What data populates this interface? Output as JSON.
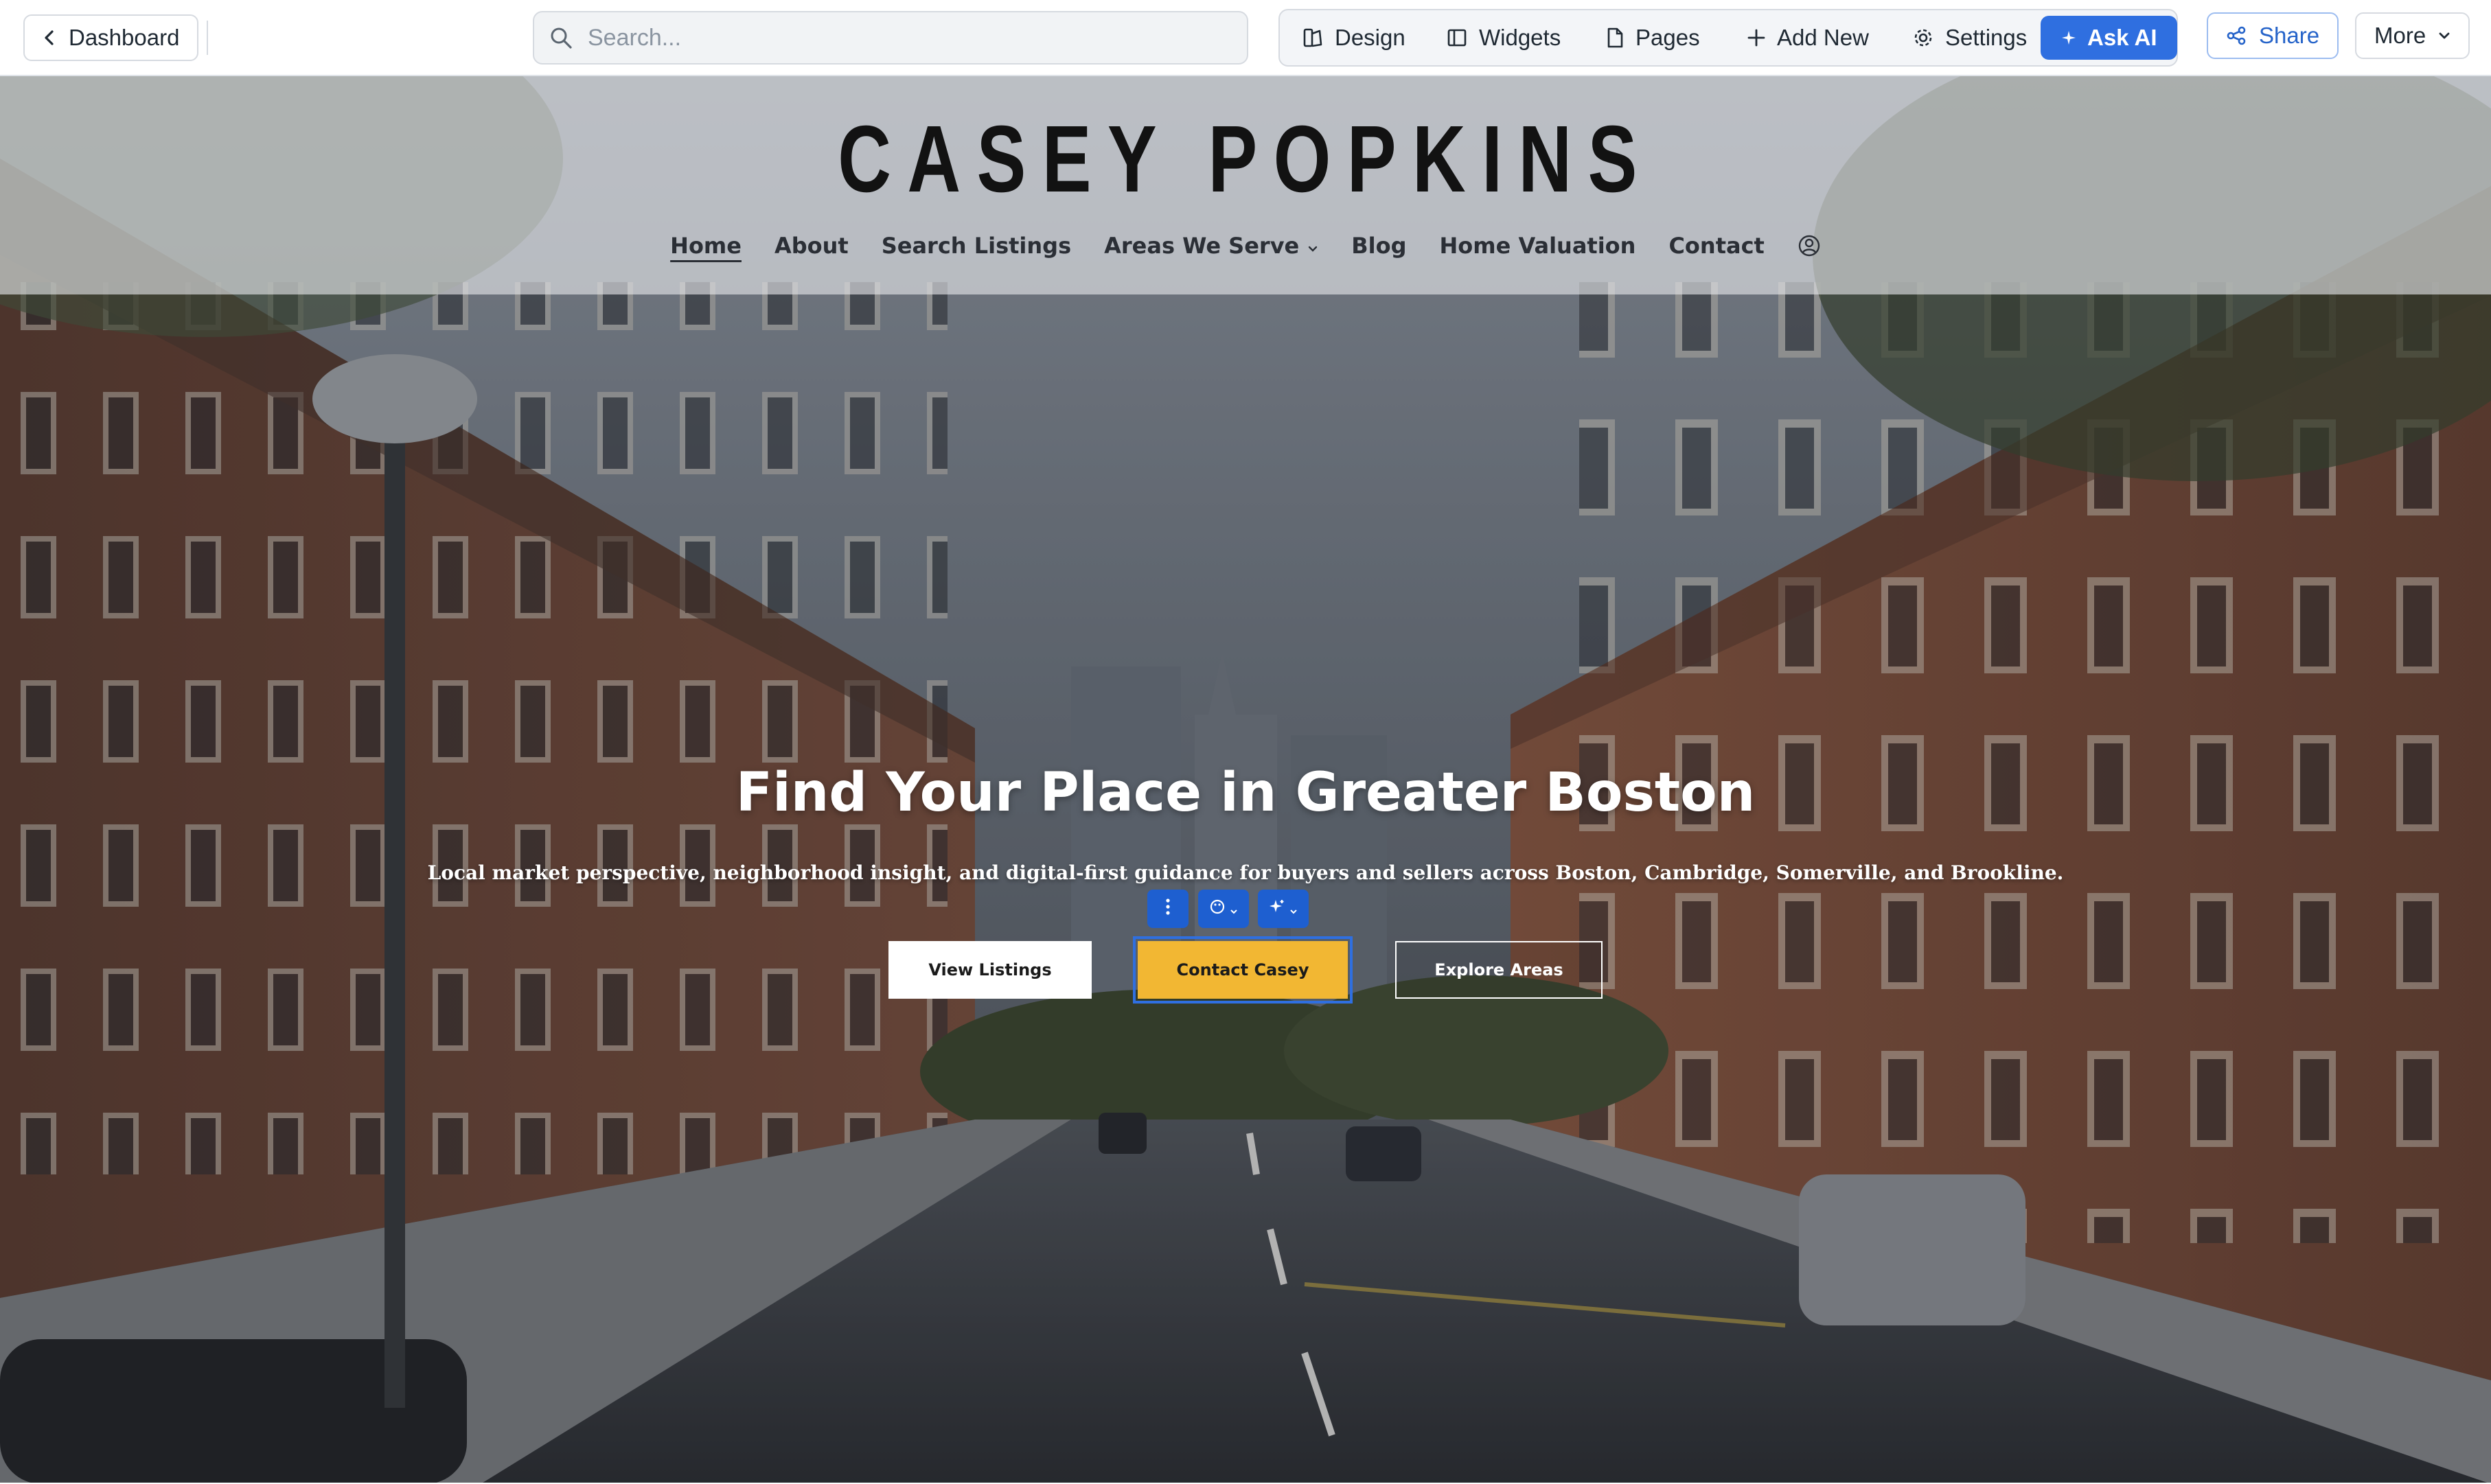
{
  "toolbar": {
    "dashboard_label": "Dashboard",
    "search_placeholder": "Search...",
    "tools": {
      "design": "Design",
      "widgets": "Widgets",
      "pages": "Pages",
      "add_new": "Add New",
      "settings": "Settings",
      "ask_ai": "Ask AI"
    },
    "share_label": "Share",
    "more_label": "More",
    "accent_color": "#2f6fe0"
  },
  "site": {
    "brand": "CASEY POPKINS",
    "nav": {
      "home": "Home",
      "about": "About",
      "search_listings": "Search Listings",
      "areas_we_serve": "Areas We Serve",
      "blog": "Blog",
      "home_valuation": "Home Valuation",
      "contact": "Contact"
    },
    "active_nav": "Home"
  },
  "hero": {
    "title": "Find Your Place in Greater Boston",
    "subtitle": "Local market perspective, neighborhood insight, and digital-first guidance for buyers and sellers across Boston, Cambridge, Somerville, and Brookline.",
    "buttons": {
      "view_listings": "View Listings",
      "contact": "Contact Casey",
      "explore": "Explore Areas"
    },
    "accent_button_color": "#f2b733",
    "background": "street-of-brownstones-photo"
  }
}
